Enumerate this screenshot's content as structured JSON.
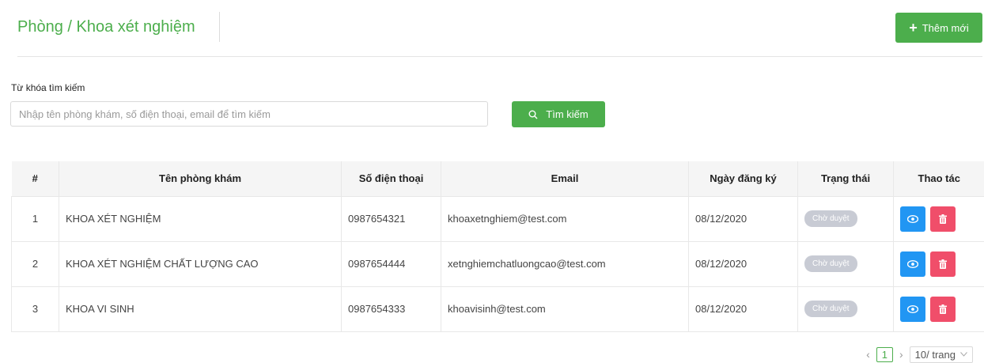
{
  "header": {
    "title": "Phòng / Khoa xét nghiệm",
    "add_button": {
      "icon": "plus-icon",
      "label": "Thêm mới"
    }
  },
  "search": {
    "label": "Từ khóa tìm kiếm",
    "placeholder": "Nhập tên phòng khám, số điện thoại, email để tìm kiếm",
    "value": "",
    "button": {
      "icon": "search-icon",
      "label": "Tìm kiếm"
    }
  },
  "table": {
    "columns": [
      "#",
      "Tên phòng khám",
      "Số điện thoại",
      "Email",
      "Ngày đăng ký",
      "Trạng thái",
      "Thao tác"
    ],
    "rows": [
      {
        "index": "1",
        "name": "KHOA XÉT NGHIỆM",
        "phone": "0987654321",
        "email": "khoaxetnghiem@test.com",
        "date": "08/12/2020",
        "status": "Chờ duyệt"
      },
      {
        "index": "2",
        "name": "KHOA XÉT NGHIỆM CHẤT LƯỢNG CAO",
        "phone": "0987654444",
        "email": "xetnghiemchatluongcao@test.com",
        "date": "08/12/2020",
        "status": "Chờ duyệt"
      },
      {
        "index": "3",
        "name": "KHOA VI SINH",
        "phone": "0987654333",
        "email": "khoavisinh@test.com",
        "date": "08/12/2020",
        "status": "Chờ duyệt"
      }
    ],
    "actions": [
      {
        "icon": "eye-icon",
        "color": "#2196f3"
      },
      {
        "icon": "trash-icon",
        "color": "#f04e6a"
      }
    ]
  },
  "pagination": {
    "current_page": "1",
    "page_size": "10/ trang"
  },
  "colors": {
    "primary": "#4cae4c",
    "view": "#2196f3",
    "delete": "#f04e6a",
    "status_badge": "#c8cbd4"
  }
}
